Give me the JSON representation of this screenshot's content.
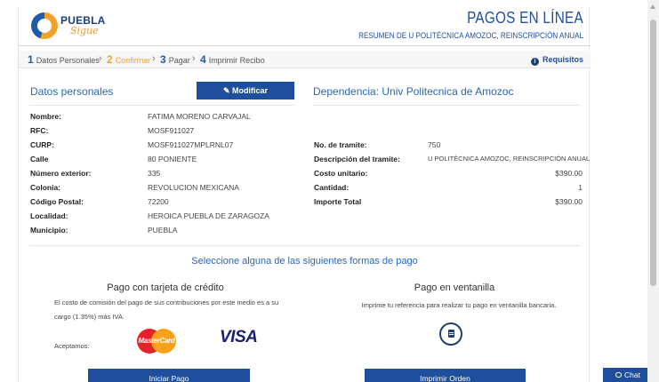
{
  "header": {
    "logo_text": "PUEBLA",
    "logo_sub": "Sigue",
    "title": "PAGOS EN LÍNEA",
    "subtitle": "RESUMEN DE U POLITÉCNICA AMOZOC, REINSCRIPCIÓN ANUAL"
  },
  "steps": [
    {
      "num": "1",
      "label": "Datos Personales"
    },
    {
      "num": "2",
      "label": "Confirmar"
    },
    {
      "num": "3",
      "label": "Pagar"
    },
    {
      "num": "4",
      "label": "Imprimir Recibo"
    }
  ],
  "requisitos": "Requisitos",
  "personal": {
    "title": "Datos personales",
    "modify_label": "Modificar",
    "rows": [
      {
        "label": "Nombre:",
        "value": "FATIMA MORENO CARVAJAL"
      },
      {
        "label": "RFC:",
        "value": "MOSF911027"
      },
      {
        "label": "CURP:",
        "value": "MOSF911027MPLRNL07"
      },
      {
        "label": "Calle",
        "value": "80 PONIENTE"
      },
      {
        "label": "Número exterior:",
        "value": "335"
      },
      {
        "label": "Colonia:",
        "value": "REVOLUCION MEXICANA"
      },
      {
        "label": "Código Postal:",
        "value": "72200"
      },
      {
        "label": "Localidad:",
        "value": "HEROICA PUEBLA DE ZARAGOZA"
      },
      {
        "label": "Municipio:",
        "value": "PUEBLA"
      }
    ]
  },
  "dependencia": {
    "title": "Dependencia: Univ Politecnica de Amozoc",
    "rows": [
      {
        "label": "No. de tramite:",
        "value": "750"
      },
      {
        "label": "Descripción del tramite:",
        "value": "U POLITÉCNICA AMOZOC, REINSCRIPCIÓN ANUAL"
      },
      {
        "label": "Costo unitario:",
        "value": "$390.00"
      },
      {
        "label": "Cantidad:",
        "value": "1"
      },
      {
        "label": "Importe Total",
        "value": "$390.00"
      }
    ]
  },
  "payment": {
    "title": "Seleccione alguna de las siguientes formas de pago",
    "card": {
      "title": "Pago con tarjeta de crédito",
      "text_line1": "El costo de comisión del pago de sus contribuciones por este medio es a su",
      "text_line2": "cargo (1.35%) más IVA.",
      "accept_label": "Aceptamos:",
      "mastercard_label": "MasterCard",
      "visa_label": "VISA",
      "button": "Iniciar Pago"
    },
    "window": {
      "title": "Pago en ventanilla",
      "text": "Imprime tu referencia para realizar tu pago en ventanilla bancaria.",
      "button": "Imprimir Orden"
    }
  },
  "chat_label": "Chat"
}
